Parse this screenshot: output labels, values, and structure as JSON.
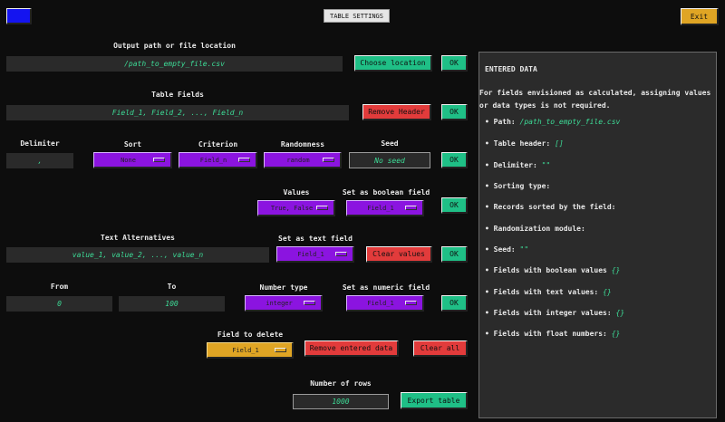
{
  "top": {
    "title": "TABLE SETTINGS",
    "corner_icon": "blue-square-icon",
    "exit_label": "Exit"
  },
  "output": {
    "label": "Output path or file location",
    "value": "/path_to_empty_file.csv",
    "choose_label": "Choose location",
    "ok_label": "OK"
  },
  "table_fields": {
    "label": "Table Fields",
    "value": "Field_1, Field_2, ..., Field_n",
    "remove_label": "Remove Header",
    "ok_label": "OK"
  },
  "options_row": {
    "delimiter_label": "Delimiter",
    "delimiter_value": ",",
    "sort_label": "Sort",
    "sort_value": "None",
    "criterion_label": "Criterion",
    "criterion_value": "Field_n",
    "randomness_label": "Randomness",
    "randomness_value": "random",
    "seed_label": "Seed",
    "seed_value": "No seed",
    "ok_label": "OK"
  },
  "boolean": {
    "values_label": "Values",
    "values_value": "True, False",
    "set_label": "Set as boolean field",
    "set_value": "Field_1",
    "ok_label": "OK"
  },
  "text": {
    "alternatives_label": "Text Alternatives",
    "alternatives_value": "value_1, value_2, ..., value_n",
    "set_label": "Set as text field",
    "set_value": "Field_1",
    "clear_label": "Clear values",
    "ok_label": "OK"
  },
  "numeric": {
    "from_label": "From",
    "from_value": "0",
    "to_label": "To",
    "to_value": "100",
    "type_label": "Number type",
    "type_value": "integer",
    "set_label": "Set as numeric field",
    "set_value": "Field_1",
    "ok_label": "OK"
  },
  "delete": {
    "label": "Field to delete",
    "value": "Field_1",
    "remove_entered_label": "Remove entered data",
    "clear_all_label": "Clear all"
  },
  "rows": {
    "label": "Number of rows",
    "value": "1000",
    "export_label": "Export table"
  },
  "panel": {
    "title": "ENTERED DATA",
    "note": "For fields envisioned as calculated, assigning values or data types is not required.",
    "items": [
      {
        "label": "• Path:",
        "value": "/path_to_empty_file.csv"
      },
      {
        "label": "• Table header:",
        "value": "[]"
      },
      {
        "label": "• Delimiter:",
        "value": "\"\""
      },
      {
        "label": "• Sorting type:",
        "value": ""
      },
      {
        "label": "• Records sorted by the field:",
        "value": ""
      },
      {
        "label": "• Randomization module:",
        "value": ""
      },
      {
        "label": "• Seed:",
        "value": "\"\""
      },
      {
        "label": "• Fields with boolean values",
        "value": "{}"
      },
      {
        "label": "• Fields with text values:",
        "value": "{}"
      },
      {
        "label": "• Fields with integer values:",
        "value": "{}"
      },
      {
        "label": "• Fields with float numbers:",
        "value": "{}"
      }
    ]
  },
  "colors": {
    "background": "#0d0d0d",
    "green": "#1fbf86",
    "red": "#e23b3b",
    "yellow": "#e0a524",
    "purple": "#8b14e0",
    "blue": "#1414f0",
    "accent_text": "#3ddc97"
  }
}
